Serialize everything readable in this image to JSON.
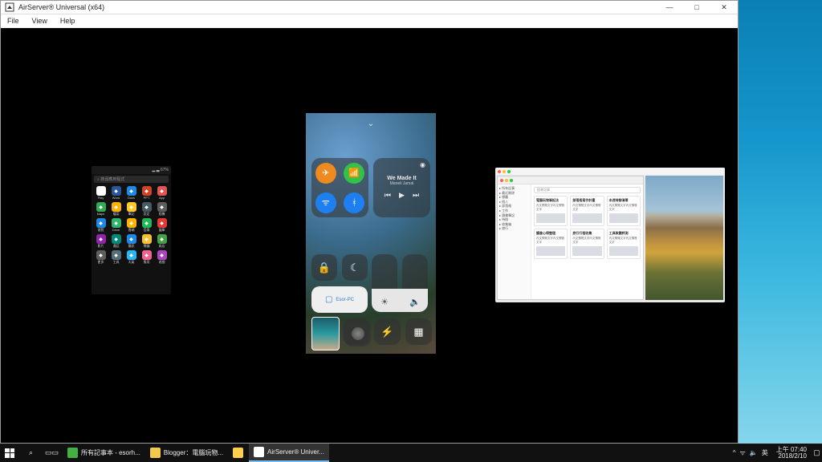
{
  "window": {
    "title": "AirServer® Universal (x64)",
    "menu": {
      "file": "File",
      "view": "View",
      "help": "Help"
    },
    "controls": {
      "min": "—",
      "max": "□",
      "close": "✕"
    }
  },
  "android": {
    "search_placeholder": "搜尋應用程式",
    "apps": [
      {
        "label": "Play",
        "color": "#fff"
      },
      {
        "label": "Word",
        "color": "#2b579a"
      },
      {
        "label": "Docs",
        "color": "#1e88e5"
      },
      {
        "label": "PPT",
        "color": "#d04423"
      },
      {
        "label": "App",
        "color": "#e25555"
      },
      {
        "label": "Maps",
        "color": "#36a853"
      },
      {
        "label": "檔案",
        "color": "#ffb300"
      },
      {
        "label": "筆記",
        "color": "#ffca28"
      },
      {
        "label": "設定",
        "color": "#455a64"
      },
      {
        "label": "相機",
        "color": "#5e5e5e"
      },
      {
        "label": "瀏覽",
        "color": "#1e88e5"
      },
      {
        "label": "Drive",
        "color": "#2db56b"
      },
      {
        "label": "雲端",
        "color": "#ffb300"
      },
      {
        "label": "音樂",
        "color": "#1db954"
      },
      {
        "label": "圖庫",
        "color": "#e53935"
      },
      {
        "label": "影片",
        "color": "#8e24aa"
      },
      {
        "label": "通話",
        "color": "#00897b"
      },
      {
        "label": "簡訊",
        "color": "#1e88e5"
      },
      {
        "label": "鬧鐘",
        "color": "#fbc02d"
      },
      {
        "label": "商店",
        "color": "#43a047"
      },
      {
        "label": "更多",
        "color": "#5e5e5e"
      },
      {
        "label": "工具",
        "color": "#546e7a"
      },
      {
        "label": "天氣",
        "color": "#29b6f6"
      },
      {
        "label": "應用",
        "color": "#f06292"
      },
      {
        "label": "遊戲",
        "color": "#ab47bc"
      }
    ]
  },
  "ios": {
    "music_title": "We Made It",
    "music_artist": "Maneli Jamal",
    "mirror_target": "Esor-PC",
    "icons": {
      "airplane": "✈",
      "cell": "📶",
      "wifi": "ᯤ",
      "bt": "ᚼ",
      "prev": "⏮",
      "play": "▶",
      "next": "⏭",
      "lock": "🔒",
      "moon": "☾",
      "bright": "☀",
      "vol": "🔈",
      "timer": "⏱",
      "flash": "⚡",
      "calc": "▦",
      "screen": "▢"
    }
  },
  "mac": {
    "sidebar_items": [
      "所有記事",
      "最近刪除",
      "標籤",
      "個人",
      "部落格",
      "工作",
      "讀書筆記",
      "待辦",
      "收集箱",
      "旅行"
    ],
    "search_placeholder": "搜尋記事",
    "notes": [
      {
        "h": "電腦玩物筆記法"
      },
      {
        "h": "部落格寫作計畫"
      },
      {
        "h": "本週待辦清單"
      },
      {
        "h": "讀書心得整理"
      },
      {
        "h": "旅行行程收集"
      },
      {
        "h": "工具軟體評測"
      }
    ]
  },
  "taskbar": {
    "items": [
      {
        "icon": "evernote",
        "label": "所有記事本 - esorh...",
        "color": "#44b044"
      },
      {
        "icon": "chrome",
        "label": "Blogger：電腦玩物...",
        "color": "#f2c94c"
      },
      {
        "icon": "explorer",
        "label": "",
        "color": "#ffcf4b"
      },
      {
        "icon": "airserver",
        "label": "AirServer® Univer...",
        "color": "#ffffff"
      }
    ],
    "ime_lang": "英",
    "time": "上午 07:40",
    "date": "2018/2/10",
    "tray": {
      "up": "^",
      "net": "ᯤ",
      "vol": "🔈",
      "pwr": "⬜"
    }
  }
}
